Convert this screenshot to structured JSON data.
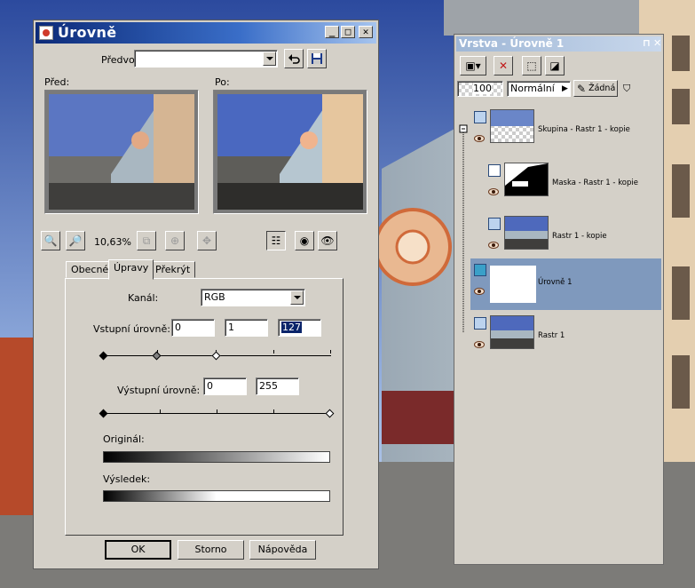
{
  "levels_dialog": {
    "title": "Úrovně",
    "window_buttons": {
      "minimize": "_",
      "maximize": "□",
      "close": "✕"
    },
    "presets_label": "Předvolby:",
    "presets_value": "",
    "before_label": "Před:",
    "after_label": "Po:",
    "zoom_level": "10,63%",
    "tabs": [
      "Obecné",
      "Úpravy",
      "Překrýt"
    ],
    "active_tab": "Úpravy",
    "channel_label": "Kanál:",
    "channel_value": "RGB",
    "input_levels_label": "Vstupní úrovně:",
    "input_levels": [
      "0",
      "1",
      "127"
    ],
    "output_levels_label": "Výstupní úrovně:",
    "output_levels": [
      "0",
      "255"
    ],
    "original_label": "Originál:",
    "result_label": "Výsledek:",
    "buttons": {
      "ok": "OK",
      "cancel": "Storno",
      "help": "Nápověda"
    }
  },
  "layers_palette": {
    "title": "Vrstva - Úrovně 1",
    "pin": "⊓",
    "close": "✕",
    "opacity": "100",
    "blend_mode": "Normální",
    "lock_label": "Žádná",
    "layers": [
      {
        "name": "Skupina - Rastr 1 - kopie",
        "type": "group",
        "selected": false
      },
      {
        "name": "Maska - Rastr 1 - kopie",
        "type": "mask",
        "selected": false
      },
      {
        "name": "Rastr 1 - kopie",
        "type": "raster",
        "selected": false
      },
      {
        "name": "Úrovně 1",
        "type": "adjustment",
        "selected": true
      },
      {
        "name": "Rastr 1",
        "type": "raster",
        "selected": false
      }
    ]
  },
  "colors": {
    "dialog_face": "#d4d0c8",
    "title_bar_start": "#0c2a78",
    "title_bar_end": "#a6c4ee",
    "selected_layer": "#7f99bd",
    "input_selection": "#0a246a"
  }
}
